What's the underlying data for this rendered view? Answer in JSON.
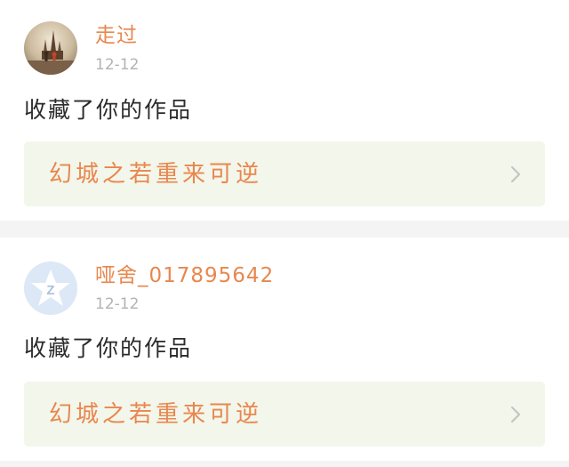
{
  "notifications": [
    {
      "username": "走过",
      "date": "12-12",
      "action": "收藏了你的作品",
      "work_title": "幻城之若重来可逆",
      "avatar_icon": "castle-photo-avatar",
      "chevron_icon": "chevron-right-icon"
    },
    {
      "username": "哑舍_017895642",
      "date": "12-12",
      "action": "收藏了你的作品",
      "work_title": "幻城之若重来可逆",
      "avatar_icon": "default-star-avatar",
      "chevron_icon": "chevron-right-icon"
    }
  ],
  "colors": {
    "accent": "#e8874e",
    "date_gray": "#b3b3b3",
    "link_bg": "#f3f6ea",
    "page_bg": "#f4f4f4",
    "default_avatar": "#dce8f5"
  }
}
